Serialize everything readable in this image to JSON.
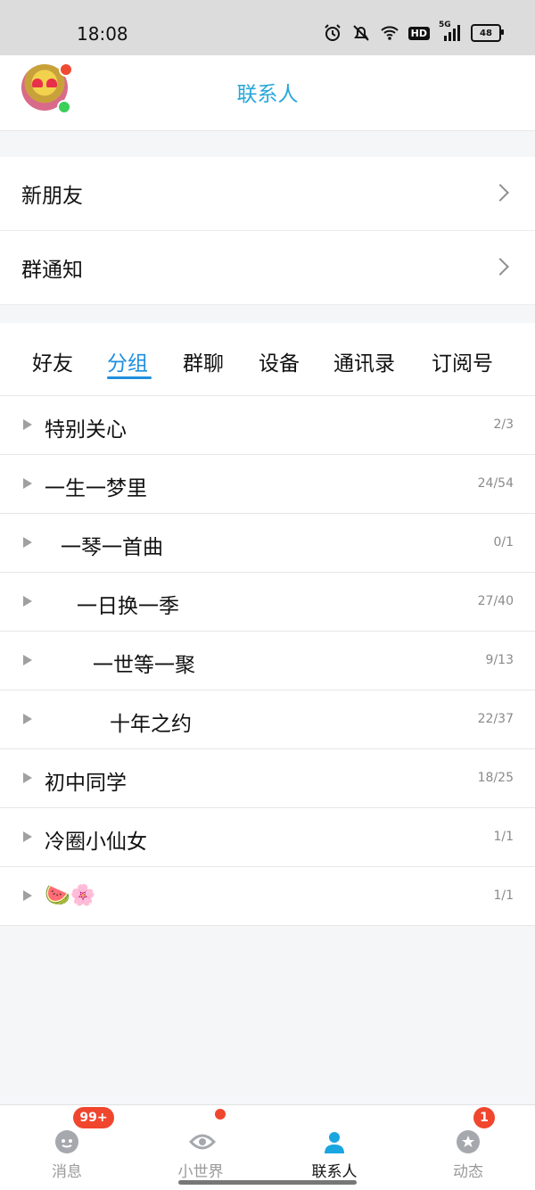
{
  "status_bar": {
    "time": "18:08",
    "hd_label": "HD",
    "network_label": "5G",
    "battery_level": "48",
    "icons": [
      "alarm-icon",
      "mute-icon",
      "wifi-icon",
      "hd-icon",
      "signal-icon",
      "battery-icon"
    ]
  },
  "header": {
    "title": "联系人"
  },
  "quick_links": [
    {
      "label": "新朋友"
    },
    {
      "label": "群通知"
    }
  ],
  "tabs": [
    {
      "label": "好友",
      "active": false
    },
    {
      "label": "分组",
      "active": true
    },
    {
      "label": "群聊",
      "active": false
    },
    {
      "label": "设备",
      "active": false
    },
    {
      "label": "通讯录",
      "active": false
    },
    {
      "label": "订阅号",
      "active": false
    }
  ],
  "groups": [
    {
      "name": "特别关心",
      "count": "2/3"
    },
    {
      "name": "一生一梦里",
      "count": "24/54"
    },
    {
      "name": "一琴一首曲",
      "count": "0/1"
    },
    {
      "name": "一日换一季",
      "count": "27/40"
    },
    {
      "name": "一世等一聚",
      "count": "9/13"
    },
    {
      "name": "十年之约",
      "count": "22/37"
    },
    {
      "name": "初中同学",
      "count": "18/25"
    },
    {
      "name": "冷圈小仙女",
      "count": "1/1"
    },
    {
      "name": "🍉🌸",
      "count": "1/1"
    }
  ],
  "bottom_nav": {
    "items": [
      {
        "label": "消息",
        "icon": "chat-bubble-icon",
        "badge": "99+",
        "active": false
      },
      {
        "label": "小世界",
        "icon": "eye-icon",
        "active": false
      },
      {
        "label": "联系人",
        "icon": "person-icon",
        "active": true
      },
      {
        "label": "动态",
        "icon": "star-icon",
        "badge": "1",
        "active": false
      }
    ]
  },
  "colors": {
    "accent": "#1d8fdf",
    "title": "#27a7d8",
    "badge": "#f0462e"
  }
}
